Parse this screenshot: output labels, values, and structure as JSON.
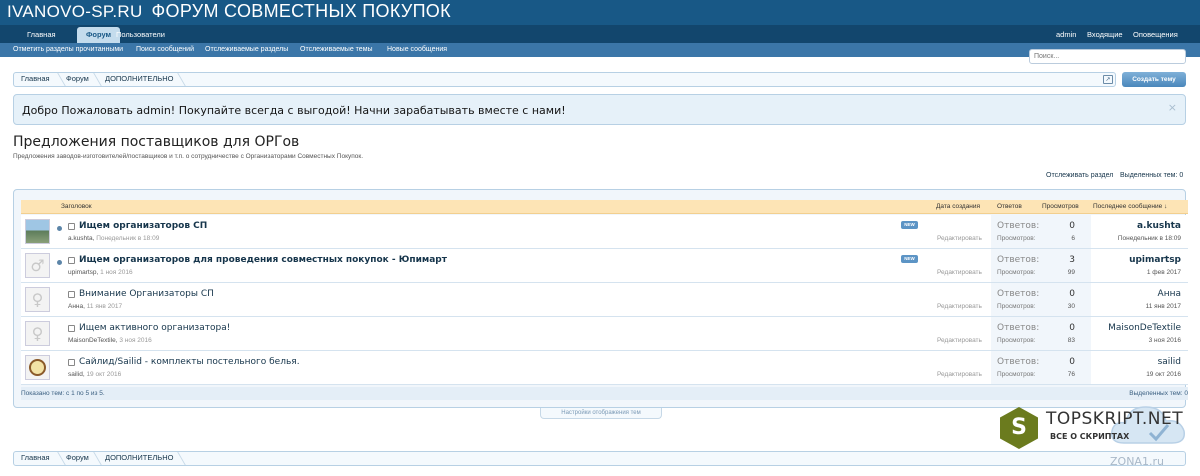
{
  "header": {
    "logo_part1": "IVANOVO-SP.RU",
    "logo_part2": "ФОРУМ СОВМЕСТНЫХ ПОКУПОК"
  },
  "nav": {
    "tabs": [
      "Главная",
      "Форум",
      "Пользователи"
    ],
    "active_tab": "Форум",
    "right": [
      "admin",
      "Входящие",
      "Оповещения"
    ]
  },
  "subnav": [
    "Отметить разделы прочитанными",
    "Поиск сообщений",
    "Отслеживаемые разделы",
    "Отслеживаемые темы",
    "Новые сообщения"
  ],
  "search": {
    "placeholder": "Поиск..."
  },
  "breadcrumb": [
    "Главная",
    "Форум",
    "ДОПОЛНИТЕЛЬНО"
  ],
  "create_thread_button": "Создать тему",
  "notice": {
    "text": "Добро Пожаловать admin! Покупайте всегда с выгодой! Начни зарабатывать вместе с нами!",
    "close": "×"
  },
  "page": {
    "title": "Предложения поставщиков для ОРГов",
    "description": "Предложения заводов-изготовителей/поставщиков и т.п. о сотрудничестве с Организаторами Совместных Покупок.",
    "watch_forum": "Отслеживать раздел",
    "selected_threads_label": "Выделенных тем:",
    "selected_threads_count": "0"
  },
  "list_header": {
    "title": "Заголовок",
    "created": "Дата создания",
    "replies": "Ответов",
    "views": "Просмотров",
    "last_post": "Последнее сообщение ↓"
  },
  "threads": [
    {
      "title": "Ищем организаторов СП",
      "author": "a.kushta",
      "date": "Понедельник в 18:09",
      "unread": true,
      "new": "NEW",
      "edit": "Редактировать",
      "replies_label": "Ответов:",
      "replies": "0",
      "views_label": "Просмотров:",
      "views": "6",
      "last_user": "a.kushta",
      "last_date": "Понедельник в 18:09",
      "avatar": "photo-avatar"
    },
    {
      "title": "Ищем организаторов для проведения совместных покупок - Юпимарт",
      "author": "upimartsp",
      "date": "1 ноя 2016",
      "unread": true,
      "new": "NEW",
      "edit": "Редактировать",
      "replies_label": "Ответов:",
      "replies": "3",
      "views_label": "Просмотров:",
      "views": "99",
      "last_user": "upimartsp",
      "last_date": "1 фев 2017",
      "avatar": "male-avatar"
    },
    {
      "title": "Внимание Организаторы СП",
      "author": "Анна",
      "date": "11 янв 2017",
      "unread": false,
      "new": "",
      "edit": "Редактировать",
      "replies_label": "Ответов:",
      "replies": "0",
      "views_label": "Просмотров:",
      "views": "30",
      "last_user": "Анна",
      "last_date": "11 янв 2017",
      "avatar": "female-avatar"
    },
    {
      "title": "Ищем активного организатора!",
      "author": "MaisonDeTextile",
      "date": "3 ноя 2016",
      "unread": false,
      "new": "",
      "edit": "Редактировать",
      "replies_label": "Ответов:",
      "replies": "0",
      "views_label": "Просмотров:",
      "views": "83",
      "last_user": "MaisonDeTextile",
      "last_date": "3 ноя 2016",
      "avatar": "female-avatar"
    },
    {
      "title": "Сайлид/Sailid - комплекты постельного белья.",
      "author": "sailid",
      "date": "19 окт 2016",
      "unread": false,
      "new": "",
      "edit": "Редактировать",
      "replies_label": "Ответов:",
      "replies": "0",
      "views_label": "Просмотров:",
      "views": "76",
      "last_user": "sailid",
      "last_date": "19 окт 2016",
      "avatar": "logo-avatar"
    }
  ],
  "list_footer": {
    "shown": "Показано тем: с 1 по 5 из 5.",
    "selected": "Выделенных тем: 0"
  },
  "settings_tab": "Настройки отображения тем",
  "watermark": {
    "letter": "S",
    "brand": "TOPSKRIPT.NET",
    "sub": "ВСЕ О СКРИПТАХ",
    "zona": "ZONA1.ru"
  },
  "colors": {
    "header": "#185886",
    "navbar": "#12466d",
    "subnav": "#3b76a8",
    "list_header": "#fde4b5",
    "notice_bg": "#e6f1f9"
  }
}
